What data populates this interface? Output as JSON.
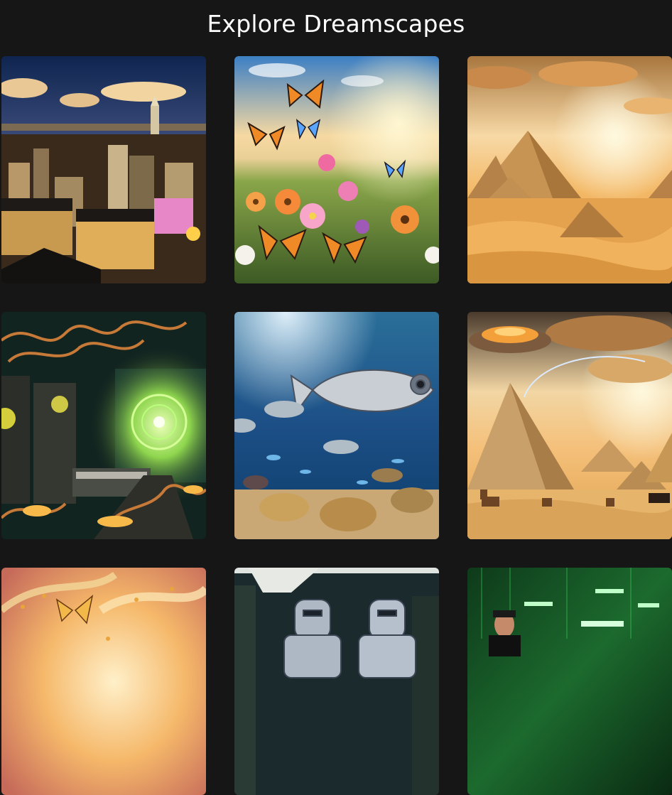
{
  "page": {
    "title": "Explore Dreamscapes"
  },
  "gallery": {
    "items": [
      {
        "icon": "city-skyline-scene"
      },
      {
        "icon": "butterfly-meadow-scene"
      },
      {
        "icon": "desert-pyramids-scene"
      },
      {
        "icon": "cyber-machine-room-scene"
      },
      {
        "icon": "underwater-robot-fish-scene"
      },
      {
        "icon": "ufo-pyramids-dogs-scene"
      },
      {
        "icon": "golden-butterfly-swirl-scene"
      },
      {
        "icon": "robots-corridor-scene"
      },
      {
        "icon": "green-matrix-scene"
      }
    ]
  },
  "colors": {
    "background": "#161616",
    "title_text": "#ffffff"
  }
}
